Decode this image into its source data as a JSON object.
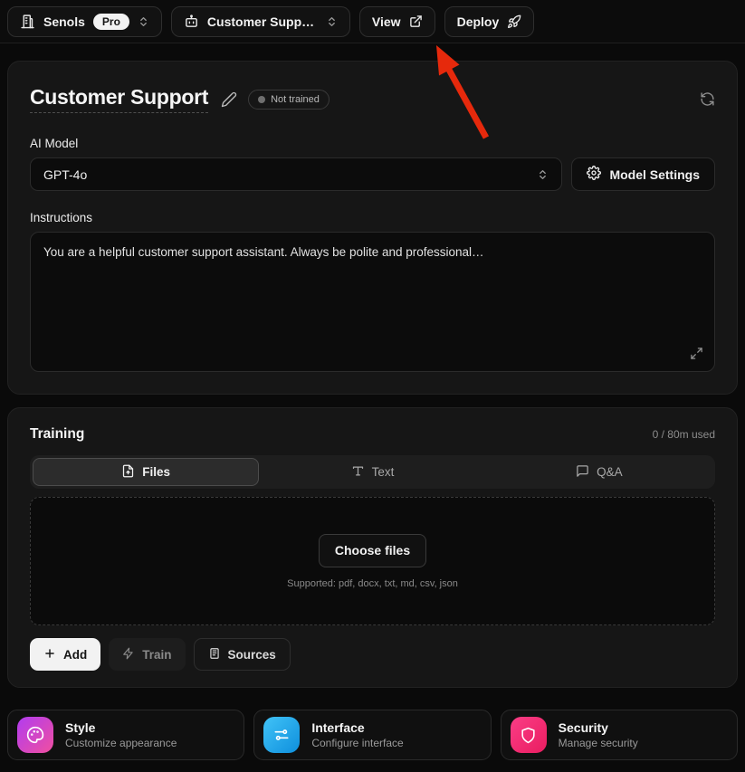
{
  "topbar": {
    "workspace_name": "Senols",
    "workspace_badge": "Pro",
    "agent_selector_value": "Customer Supp…",
    "view_label": "View",
    "deploy_label": "Deploy"
  },
  "agent": {
    "title": "Customer Support",
    "status_badge": "Not trained",
    "model_label": "AI Model",
    "model_value": "GPT-4o",
    "model_settings_label": "Model Settings",
    "instructions_label": "Instructions",
    "instructions_value": "You are a helpful customer support assistant. Always be polite and professional…"
  },
  "training": {
    "title": "Training",
    "usage": "0 / 80m used",
    "tabs": [
      {
        "label": "Files"
      },
      {
        "label": "Text"
      },
      {
        "label": "Q&A"
      }
    ],
    "choose_files_label": "Choose files",
    "supported_text": "Supported: pdf, docx, txt, md, csv, json",
    "add_label": "Add",
    "train_label": "Train",
    "sources_label": "Sources"
  },
  "cards": [
    {
      "title": "Style",
      "subtitle": "Customize appearance",
      "color_from": "#b13cf0",
      "color_to": "#f04fa0"
    },
    {
      "title": "Interface",
      "subtitle": "Configure interface",
      "color_from": "#41c3f7",
      "color_to": "#0e8fdd"
    },
    {
      "title": "Security",
      "subtitle": "Manage security",
      "color_from": "#fb3d86",
      "color_to": "#e91d60"
    }
  ],
  "annotation": {
    "color": "#e6290c"
  }
}
